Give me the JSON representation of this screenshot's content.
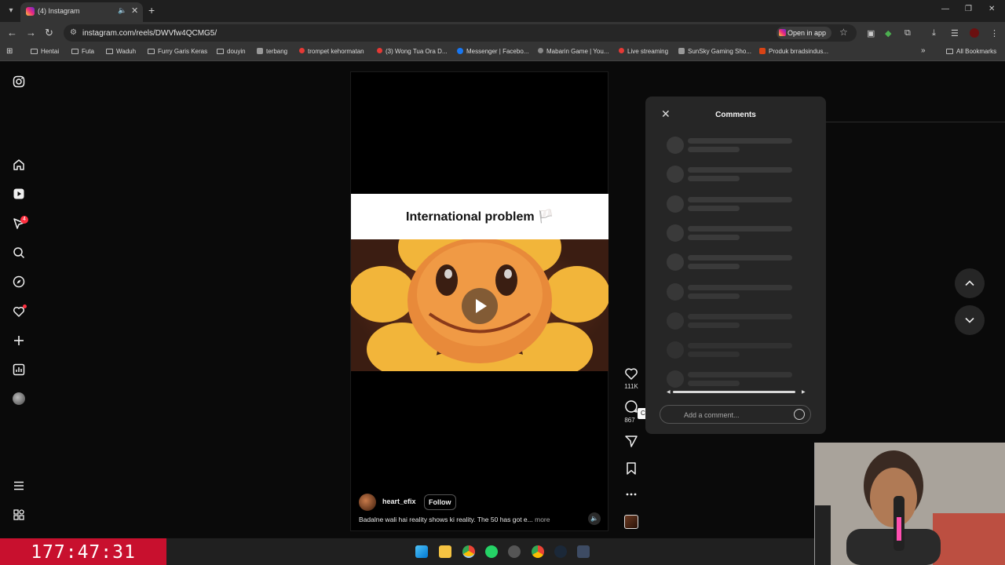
{
  "browser": {
    "tab_title": "(4) Instagram",
    "url": "instagram.com/reels/DWVfw4QCMG5/",
    "open_in_app": "Open in app",
    "bookmarks": [
      "Hentai",
      "Futa",
      "Waduh",
      "Furry Garis Keras",
      "douyin",
      "terbang",
      "trompet kehormatan",
      "(3) Wong Tua Ora D...",
      "Messenger | Facebo...",
      "Mabarin Game | You...",
      "Live streaming",
      "SunSky Gaming Sho...",
      "Produk brradsindus..."
    ],
    "all_bookmarks": "All Bookmarks"
  },
  "sidebar": {
    "notification_count": "4"
  },
  "reel": {
    "caption_title": "International problem 🏳️",
    "author": "heart_efix",
    "follow_label": "Follow",
    "description": "Badalne wali hai reality shows ki reality. The 50 has got e...",
    "more_label": "more",
    "likes": "111K",
    "comments": "867",
    "comment_tooltip": "Comment"
  },
  "comments_panel": {
    "title": "Comments",
    "input_placeholder": "Add a comment..."
  },
  "overlay": {
    "timer": "177:47:31"
  },
  "colors": {
    "background": "#0a0a0a",
    "panel": "#262626",
    "timer_bg": "#c8102e",
    "notification_red": "#ff3040"
  },
  "icons": {
    "sidebar": [
      "instagram-logo-icon",
      "home-icon",
      "reels-icon",
      "messages-icon",
      "search-icon",
      "explore-icon",
      "notifications-heart-icon",
      "create-plus-icon",
      "dashboard-icon",
      "profile-avatar",
      "more-menu-icon",
      "meta-apps-icon"
    ]
  }
}
